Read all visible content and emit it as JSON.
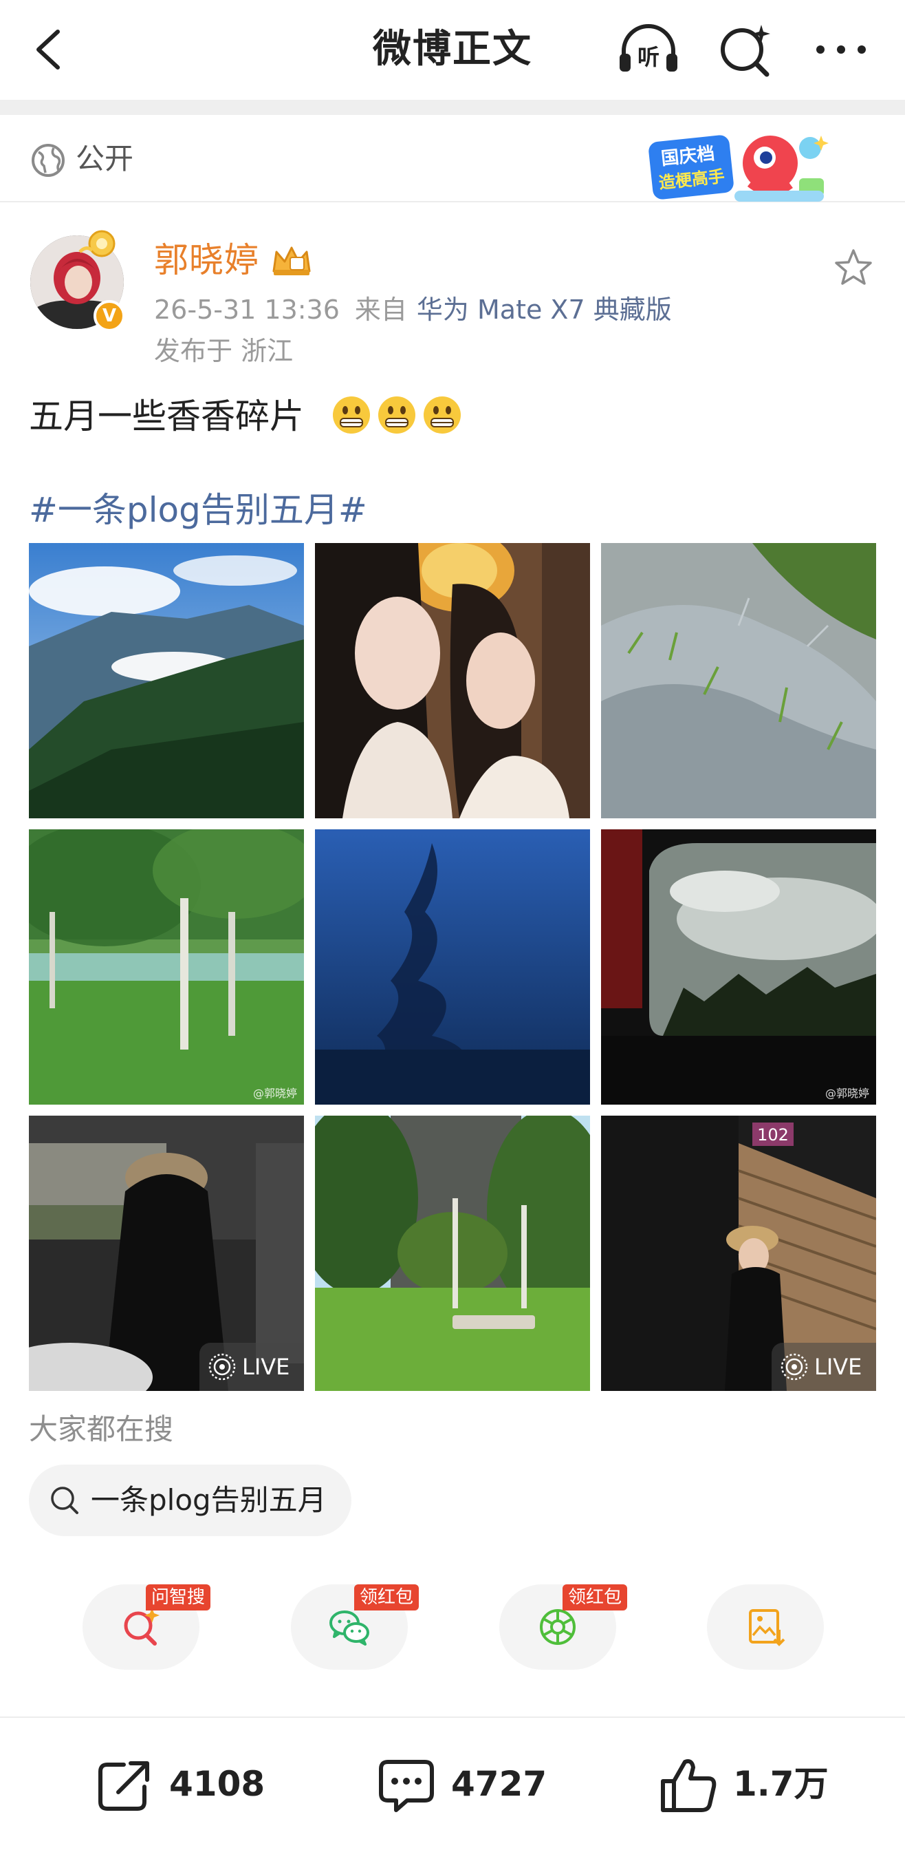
{
  "header": {
    "title": "微博正文",
    "listen_icon_text": "听"
  },
  "visibility": {
    "label": "公开"
  },
  "promo_badge": {
    "text_line1": "国庆档",
    "text_line2": "造梗高手"
  },
  "post": {
    "author": "郭晓婷",
    "date": "26-5-31 13:36",
    "from_label": "来自",
    "device": "华为 Mate X7 典藏版",
    "location": "发布于 浙江",
    "text": "五月一些香香碎片",
    "hashtag": "#一条plog告别五月#",
    "images": [
      {
        "live": false,
        "watermark": ""
      },
      {
        "live": false,
        "watermark": ""
      },
      {
        "live": false,
        "watermark": ""
      },
      {
        "live": false,
        "watermark": "@郭晓婷"
      },
      {
        "live": false,
        "watermark": ""
      },
      {
        "live": false,
        "watermark": "@郭晓婷"
      },
      {
        "live": true,
        "live_label": "LIVE"
      },
      {
        "live": false
      },
      {
        "live": true,
        "live_label": "LIVE",
        "room_number": "102"
      }
    ]
  },
  "search_section": {
    "title": "大家都在搜",
    "chip": "一条plog告别五月"
  },
  "actions": [
    {
      "tag": "问智搜",
      "icon": "ai-search-icon"
    },
    {
      "tag": "领红包",
      "icon": "wechat-icon"
    },
    {
      "tag": "领红包",
      "icon": "moments-icon"
    },
    {
      "tag": "",
      "icon": "save-image-icon"
    }
  ],
  "stats": {
    "reposts": "4108",
    "comments": "4727",
    "likes": "1.7万"
  },
  "colors": {
    "author_name": "#e8802b",
    "link": "#4c6a9d",
    "tag_red": "#e7452f"
  }
}
